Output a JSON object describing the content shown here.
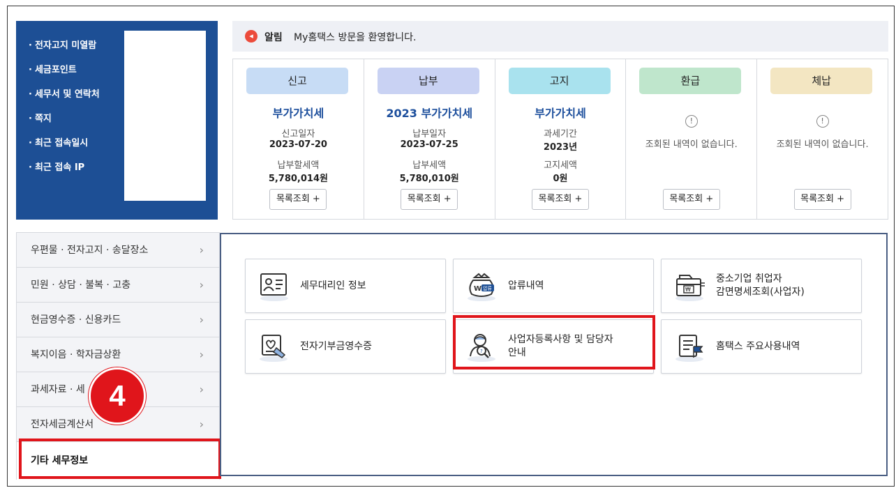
{
  "info_panel": {
    "items": [
      "전자고지 미열람",
      "세금포인트",
      "세무서 및 연락처",
      "쪽지",
      "최근 접속일시",
      "최근 접속 IP"
    ]
  },
  "notice": {
    "icon": "megaphone-icon",
    "label": "알림",
    "text": "My홈택스 방문을 환영합니다."
  },
  "status_cards": [
    {
      "head": "신고",
      "color": "#c7dcf5",
      "title": "부가가치세",
      "lbl1": "신고일자",
      "val1": "2023-07-20",
      "lbl2": "납부할세액",
      "val2": "5,780,014원",
      "button": "목록조회 +"
    },
    {
      "head": "납부",
      "color": "#c9d2f3",
      "title": "2023 부가가치세",
      "lbl1": "납부일자",
      "val1": "2023-07-25",
      "lbl2": "납부세액",
      "val2": "5,780,010원",
      "button": "목록조회 +"
    },
    {
      "head": "고지",
      "color": "#a9e2ee",
      "title": "부가가치세",
      "lbl1": "과세기간",
      "val1": "2023년",
      "lbl2": "고지세액",
      "val2": "0원",
      "button": "목록조회 +"
    },
    {
      "head": "환급",
      "color": "#bfe6cc",
      "alert": "!",
      "empty": "조회된 내역이 없습니다.",
      "button": "목록조회 +"
    },
    {
      "head": "체납",
      "color": "#f3e6c2",
      "alert": "!",
      "empty": "조회된 내역이 없습니다.",
      "button": "목록조회 +"
    }
  ],
  "side_menu": {
    "items": [
      "우편물 · 전자고지 · 송달장소",
      "민원 · 상담 · 불복 · 고충",
      "현금영수증 · 신용카드",
      "복지이음 · 학자금상환",
      "과세자료 · 세",
      "전자세금계산서"
    ],
    "active": "기타 세무정보",
    "chevron": "›"
  },
  "step_badge": "4",
  "tiles": [
    {
      "label": "세무대리인 정보",
      "icon": "agent-card-icon"
    },
    {
      "label": "압류내역",
      "icon": "seizure-bag-icon"
    },
    {
      "label": "중소기업 취업자\n감면명세조회(사업자)",
      "icon": "wallet-won-icon"
    },
    {
      "label": "전자기부금영수증",
      "icon": "donation-receipt-icon"
    },
    {
      "label": "사업자등록사항 및 담당자\n안내",
      "icon": "person-search-icon"
    },
    {
      "label": "홈택스 주요사용내역",
      "icon": "document-flag-icon"
    }
  ]
}
